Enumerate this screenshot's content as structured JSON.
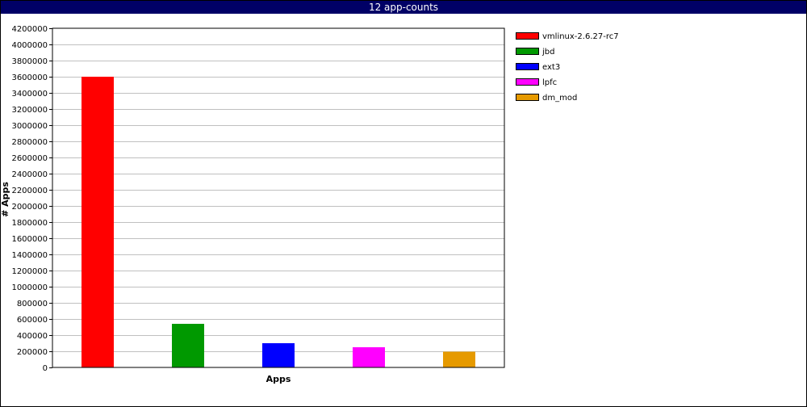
{
  "window": {
    "title": "12 app-counts"
  },
  "chart_data": {
    "type": "bar",
    "title": "12 app-counts",
    "xlabel": "Apps",
    "ylabel": "# Apps",
    "ylim": [
      0,
      4200000
    ],
    "ytick_step": 200000,
    "grid": true,
    "legend_position": "right",
    "categories": [
      "vmlinux-2.6.27-rc7",
      "jbd",
      "ext3",
      "lpfc",
      "dm_mod"
    ],
    "values": [
      3600000,
      540000,
      300000,
      250000,
      195000
    ],
    "colors": [
      "#ff0000",
      "#009900",
      "#0000ff",
      "#ff00ff",
      "#e69a00"
    ]
  }
}
